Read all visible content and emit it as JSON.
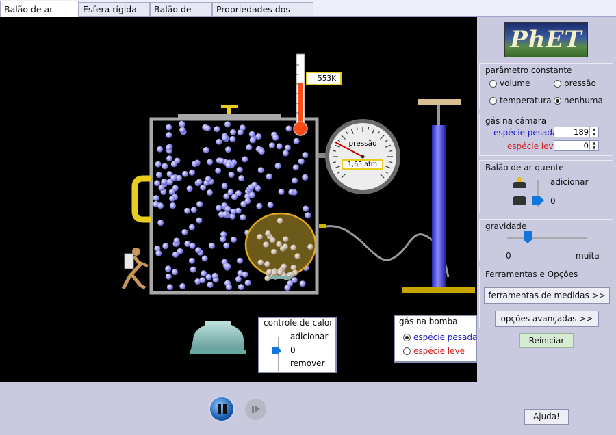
{
  "tabs": [
    "Balão de ar quente",
    "Esfera rígida oca",
    "Balão de hélio",
    "Propriedades dos Gases"
  ],
  "active_tab": 0,
  "thermometer": {
    "value": "553K"
  },
  "gauge": {
    "label": "pressão",
    "value": "1,65 atm"
  },
  "heat_control": {
    "title": "controle de calor",
    "add": "adicionar",
    "value": "0",
    "remove": "remover"
  },
  "pump_gas": {
    "title": "gás na bomba",
    "options": [
      "espécie pesada",
      "espécie leve"
    ],
    "selected": 0
  },
  "logo": {
    "text": "PhET"
  },
  "constant_param": {
    "title": "parâmetro constante",
    "options": [
      "volume",
      "pressão",
      "temperatura",
      "nenhuma"
    ],
    "selected": 3
  },
  "chamber_gas": {
    "title": "gás na câmara",
    "heavy_label": "espécie pesada",
    "heavy_value": "189",
    "light_label": "espécie leve",
    "light_value": "0"
  },
  "balloon": {
    "title": "Balão de ar quente",
    "add": "adicionar",
    "value": "0"
  },
  "gravity": {
    "title": "gravidade",
    "min": "0",
    "max": "muita",
    "level": 0.2
  },
  "tools": {
    "title": "Ferramentas e Opções",
    "measure_btn": "ferramentas de medidas >>",
    "advanced_btn": "opções avançadas >>"
  },
  "reset_btn": "Reiniciar",
  "help_btn": "Ajuda!",
  "colors": {
    "heavy": "#1a1ac8",
    "light": "#d02020",
    "thermo": "#ff4a16",
    "pump": "#4444dd",
    "lid": "#c8b400"
  }
}
